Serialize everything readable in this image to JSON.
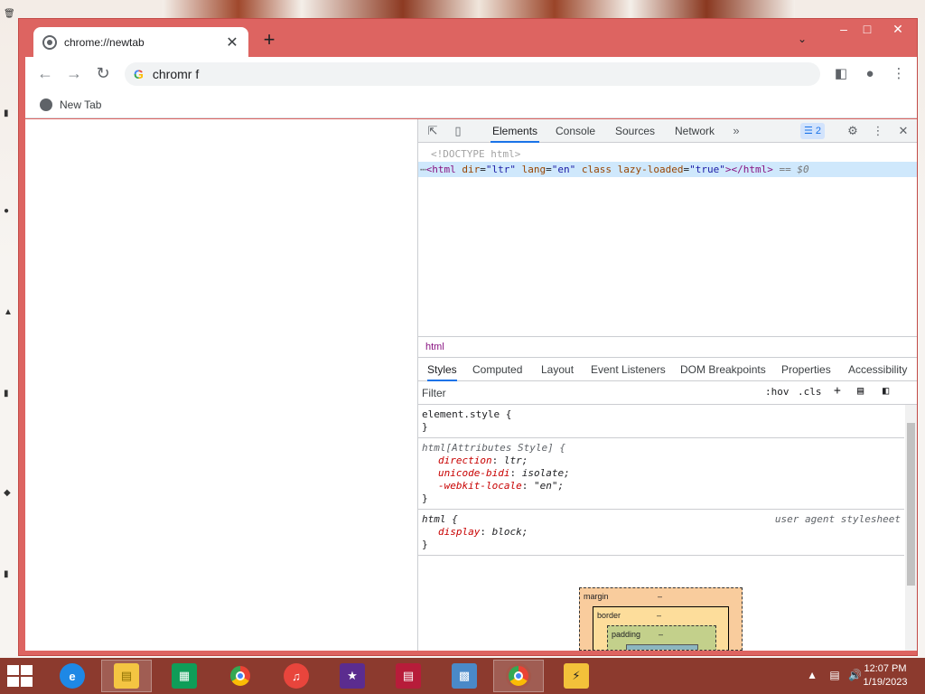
{
  "browser": {
    "tab_title": "chrome://newtab",
    "omnibox_text": "chromr f",
    "bookmark_label": "New Tab"
  },
  "devtools": {
    "tabs": [
      "Elements",
      "Console",
      "Sources",
      "Network"
    ],
    "issues_count": "2",
    "dom": {
      "doctype": "<!DOCTYPE html>",
      "html_open": "<html",
      "attr_dir": "dir",
      "val_dir": "\"ltr\"",
      "attr_lang": "lang",
      "val_lang": "\"en\"",
      "attr_class": "class",
      "attr_lazy": "lazy-loaded",
      "val_lazy": "\"true\"",
      "html_close": "></html>",
      "selected_marker": "== $0"
    },
    "breadcrumb": "html",
    "subtabs": [
      "Styles",
      "Computed",
      "Layout",
      "Event Listeners",
      "DOM Breakpoints",
      "Properties",
      "Accessibility"
    ],
    "filter_placeholder": "Filter",
    "hov_label": ":hov",
    "cls_label": ".cls",
    "rules": {
      "element_style_selector": "element.style {",
      "attr_style_selector": "html[Attributes Style] {",
      "direction_prop": "direction",
      "direction_val": "ltr;",
      "bidi_prop": "unicode-bidi",
      "bidi_val": "isolate;",
      "locale_prop": "-webkit-locale",
      "locale_val": "\"en\";",
      "html_selector": "html {",
      "display_prop": "display",
      "display_val": "block;",
      "ua_source": "user agent stylesheet",
      "close_brace": "}"
    },
    "boxmodel": {
      "margin_label": "margin",
      "border_label": "border",
      "padding_label": "padding",
      "dash": "–"
    }
  },
  "taskbar": {
    "time": "12:07 PM",
    "date": "1/19/2023"
  }
}
